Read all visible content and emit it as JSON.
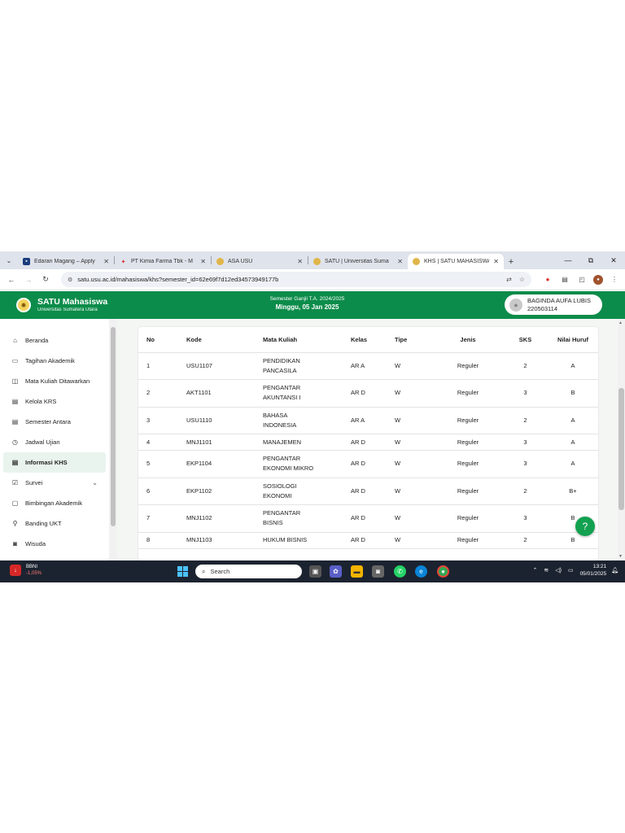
{
  "browser": {
    "tabs": [
      {
        "label": "Edaran Magang – Apply",
        "favicon": "doc-icon",
        "active": false
      },
      {
        "label": "PT Kimia Farma Tbk - M",
        "favicon": "kimia-farma-icon",
        "active": false
      },
      {
        "label": "ASA USU",
        "favicon": "usu-icon",
        "active": false
      },
      {
        "label": "SATU | Universitas Suma",
        "favicon": "usu-icon",
        "active": false
      },
      {
        "label": "KHS | SATU MAHASISWA",
        "favicon": "usu-icon",
        "active": true
      }
    ],
    "url": "satu.usu.ac.id/mahasiswa/khs?semester_id=62e69f7d12ed34573949177b"
  },
  "header": {
    "brand_name": "SATU Mahasiswa",
    "brand_sub": "Universitas Sumatera Utara",
    "semester_line": "Semester Ganjil T.A. 2024/2025",
    "date_line": "Minggu, 05 Jan 2025",
    "user_name": "BAGINDA AUFA LUBIS",
    "user_nim": "220503114"
  },
  "sidebar": {
    "items": [
      {
        "label": "Beranda",
        "icon": "home-icon",
        "glyph": "⌂"
      },
      {
        "label": "Tagihan Akademik",
        "icon": "billing-icon",
        "glyph": "▭"
      },
      {
        "label": "Mata Kuliah Ditawarkan",
        "icon": "book-icon",
        "glyph": "◫"
      },
      {
        "label": "Kelola KRS",
        "icon": "document-icon",
        "glyph": "▤"
      },
      {
        "label": "Semester Antara",
        "icon": "document-icon",
        "glyph": "▤"
      },
      {
        "label": "Jadwal Ujian",
        "icon": "clock-icon",
        "glyph": "◷"
      },
      {
        "label": "Informasi KHS",
        "icon": "document-icon",
        "glyph": "▤"
      },
      {
        "label": "Survei",
        "icon": "checkbox-icon",
        "glyph": "☑"
      },
      {
        "label": "Bimbingan Akademik",
        "icon": "chat-icon",
        "glyph": "▢"
      },
      {
        "label": "Banding UKT",
        "icon": "bike-icon",
        "glyph": "⚲"
      },
      {
        "label": "Wisuda",
        "icon": "camera-icon",
        "glyph": "◙"
      }
    ],
    "active_index": 6
  },
  "table": {
    "headers": {
      "no": "No",
      "kode": "Kode",
      "mk": "Mata Kuliah",
      "kelas": "Kelas",
      "tipe": "Tipe",
      "jenis": "Jenis",
      "sks": "SKS",
      "nilai": "Nilai Huruf"
    },
    "rows": [
      {
        "no": "1",
        "kode": "USU1107",
        "mk1": "PENDIDIKAN",
        "mk2": "PANCASILA",
        "kelas": "AR A",
        "tipe": "W",
        "jenis": "Reguler",
        "sks": "2",
        "nilai": "A"
      },
      {
        "no": "2",
        "kode": "AKT1101",
        "mk1": "PENGANTAR",
        "mk2": "AKUNTANSI I",
        "kelas": "AR D",
        "tipe": "W",
        "jenis": "Reguler",
        "sks": "3",
        "nilai": "B"
      },
      {
        "no": "3",
        "kode": "USU1110",
        "mk1": "BAHASA",
        "mk2": "INDONESIA",
        "kelas": "AR A",
        "tipe": "W",
        "jenis": "Reguler",
        "sks": "2",
        "nilai": "A"
      },
      {
        "no": "4",
        "kode": "MNJ1101",
        "mk1": "MANAJEMEN",
        "mk2": "",
        "kelas": "AR D",
        "tipe": "W",
        "jenis": "Reguler",
        "sks": "3",
        "nilai": "A"
      },
      {
        "no": "5",
        "kode": "EKP1104",
        "mk1": "PENGANTAR",
        "mk2": "EKONOMI MIKRO",
        "kelas": "AR D",
        "tipe": "W",
        "jenis": "Reguler",
        "sks": "3",
        "nilai": "A"
      },
      {
        "no": "6",
        "kode": "EKP1102",
        "mk1": "SOSIOLOGI",
        "mk2": "EKONOMI",
        "kelas": "AR D",
        "tipe": "W",
        "jenis": "Reguler",
        "sks": "2",
        "nilai": "B+"
      },
      {
        "no": "7",
        "kode": "MNJ1102",
        "mk1": "PENGANTAR",
        "mk2": "BISNIS",
        "kelas": "AR D",
        "tipe": "W",
        "jenis": "Reguler",
        "sks": "3",
        "nilai": "B"
      },
      {
        "no": "8",
        "kode": "MNJ1103",
        "mk1": "HUKUM BISNIS",
        "mk2": "",
        "kelas": "AR D",
        "tipe": "W",
        "jenis": "Reguler",
        "sks": "2",
        "nilai": "B"
      }
    ]
  },
  "help_button": "?",
  "taskbar": {
    "weather_name": "BBNI",
    "weather_change": "-1,05%",
    "search_placeholder": "Search",
    "time": "13:21",
    "date": "05/01/2025"
  },
  "colors": {
    "brand_green": "#0c8c4a",
    "fab_green": "#12a150",
    "taskbar": "#1c2330"
  }
}
